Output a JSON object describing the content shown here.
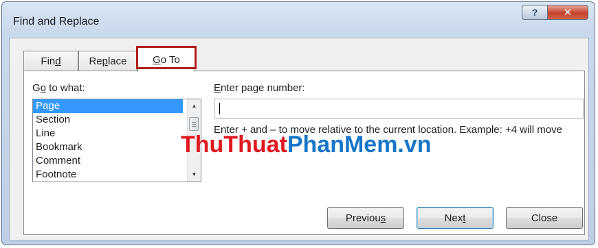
{
  "window": {
    "title": "Find and Replace",
    "help_glyph": "?",
    "close_glyph": "✕"
  },
  "tabs": {
    "find": {
      "pre": "Fin",
      "key": "d",
      "post": ""
    },
    "replace": {
      "pre": "Re",
      "key": "p",
      "post": "lace"
    },
    "goto": {
      "pre": "",
      "key": "G",
      "post": "o To"
    }
  },
  "goto_what": {
    "label_pre": "G",
    "label_key": "o",
    "label_post": " to what:",
    "items": [
      "Page",
      "Section",
      "Line",
      "Bookmark",
      "Comment",
      "Footnote"
    ],
    "selected": "Page"
  },
  "page_number": {
    "label_key": "E",
    "label_post": "nter page number:",
    "value": "",
    "hint": "Enter + and – to move relative to the current location. Example: +4 will move"
  },
  "watermark": {
    "part1": "ThuThuat",
    "part2": "PhanMem.vn"
  },
  "buttons": {
    "previous": {
      "pre": "Previou",
      "key": "s",
      "post": ""
    },
    "next": {
      "pre": "Nex",
      "key": "t",
      "post": ""
    },
    "close": {
      "pre": "Close",
      "key": "",
      "post": ""
    }
  },
  "colors": {
    "selection": "#3399ff",
    "highlight_border": "#b0201c",
    "watermark_red": "#e0181f",
    "watermark_blue": "#1676c8"
  }
}
